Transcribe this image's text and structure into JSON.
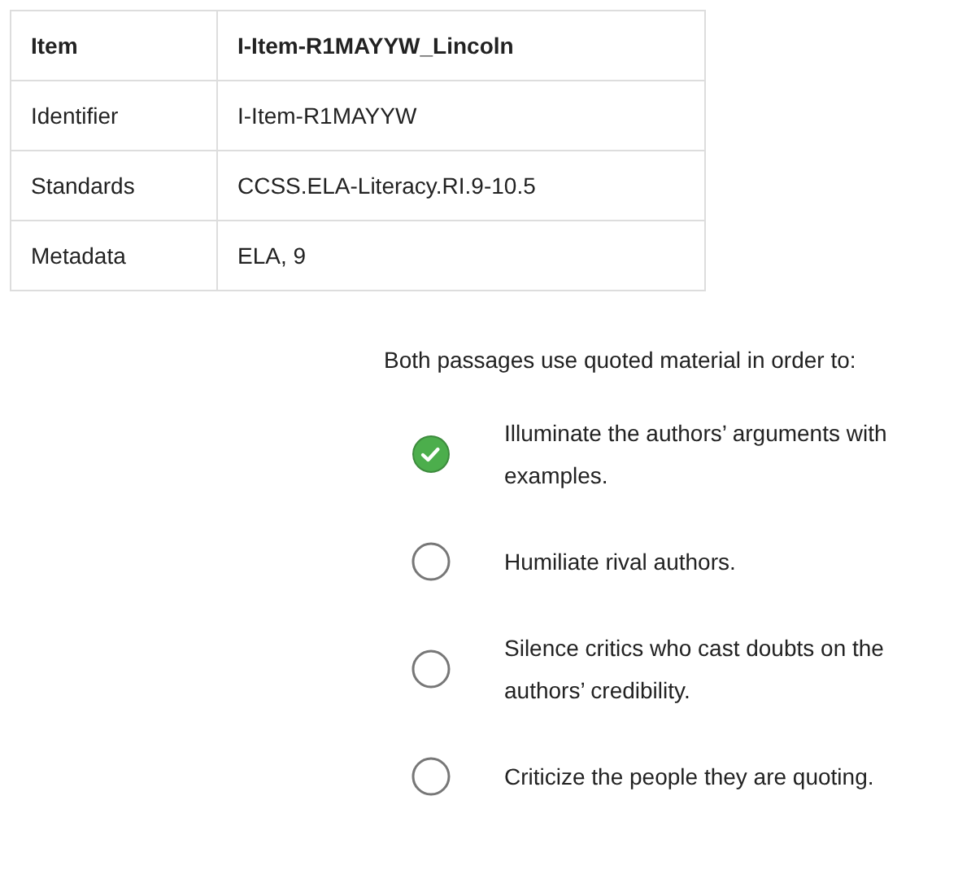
{
  "table": {
    "rows": [
      {
        "label": "Item",
        "value": "I-Item-R1MAYYW_Lincoln",
        "kind": "header"
      },
      {
        "label": "Identifier",
        "value": "I-Item-R1MAYYW",
        "kind": "body"
      },
      {
        "label": "Standards",
        "value": "CCSS.ELA-Literacy.RI.9-10.5",
        "kind": "body"
      },
      {
        "label": "Metadata",
        "value": "ELA, 9",
        "kind": "body"
      }
    ]
  },
  "question": {
    "prompt": "Both passages use quoted material in order to:",
    "options": [
      {
        "text": "Illuminate the authors’ arguments with examples.",
        "selected": true
      },
      {
        "text": "Humiliate rival authors.",
        "selected": false
      },
      {
        "text": "Silence critics who cast doubts on the authors’ credibility.",
        "selected": false
      },
      {
        "text": "Criticize the people they are quoting.",
        "selected": false
      }
    ]
  }
}
